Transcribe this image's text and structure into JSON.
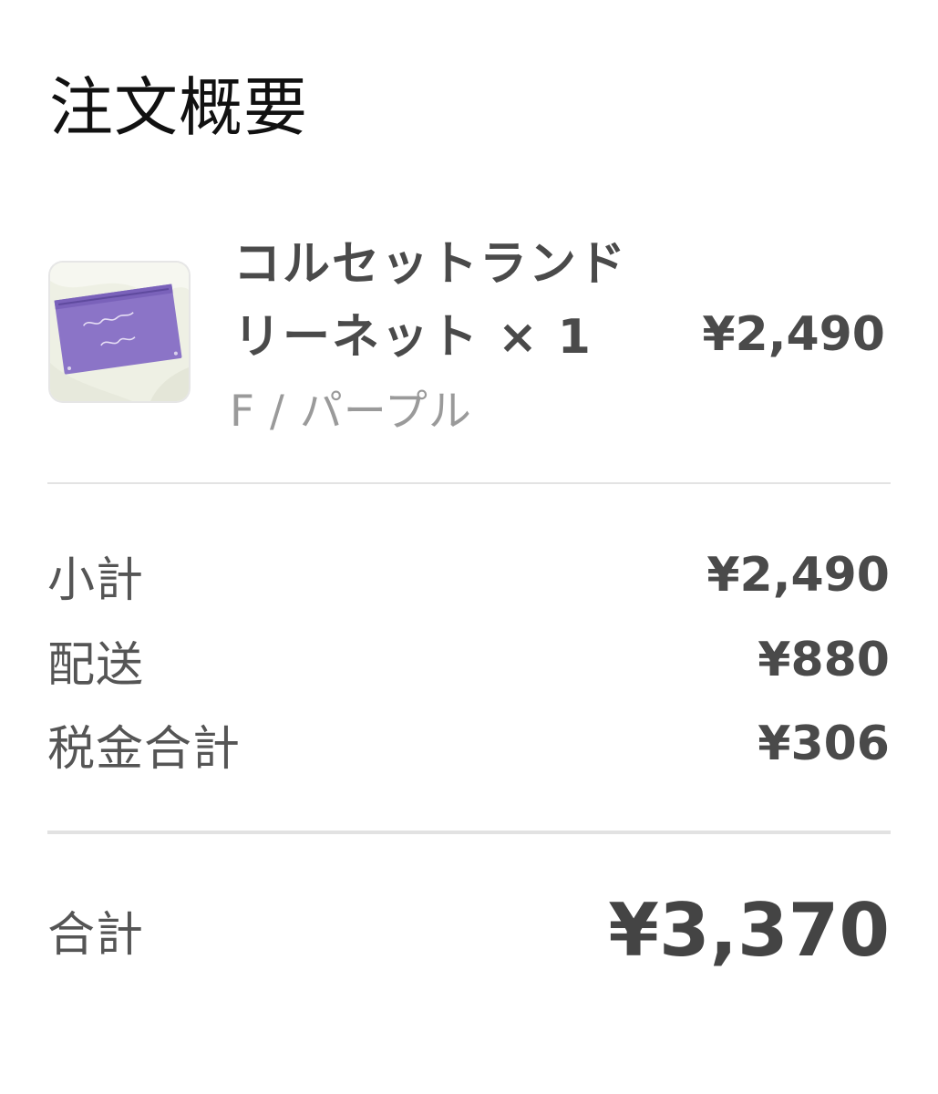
{
  "summary": {
    "title": "注文概要"
  },
  "item": {
    "name_line1": "コルセットランド",
    "name_line2": "リーネット × 1",
    "price": "¥2,490",
    "variant": "F / パープル",
    "thumbnail_icon": "product-thumbnail"
  },
  "breakdown": {
    "subtotal_label": "小計",
    "subtotal_value": "¥2,490",
    "shipping_label": "配送",
    "shipping_value": "¥880",
    "tax_label": "税金合計",
    "tax_value": "¥306"
  },
  "total": {
    "label": "合計",
    "value": "¥3,370"
  },
  "colors": {
    "text_dark": "#111111",
    "text_gray": "#555555",
    "text_light": "#9a9a9a",
    "product_purple": "#8b74c7"
  }
}
